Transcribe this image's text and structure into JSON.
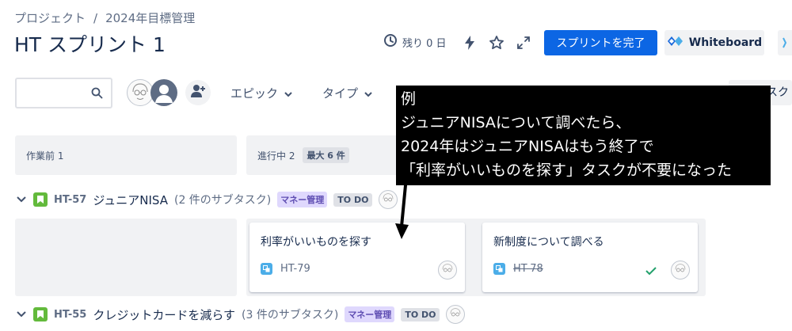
{
  "breadcrumb": {
    "project": "プロジェクト",
    "separator": "/",
    "board": "2024年目標管理"
  },
  "page_title": "HT スプリント 1",
  "header": {
    "days_left": "残り 0 日",
    "complete_sprint": "スプリントを完了",
    "whiteboard": "Whiteboard"
  },
  "filters": {
    "search_placeholder": "",
    "epic": "エピック",
    "type": "タイプ",
    "right_partial": "タスク"
  },
  "columns": [
    {
      "label": "作業前 1"
    },
    {
      "label": "進行中 2",
      "max_badge": "最大 6 件"
    }
  ],
  "swimlanes": [
    {
      "key": "HT-57",
      "title": "ジュニアNISA",
      "count": "(2 件のサブタスク)",
      "label": "マネー管理",
      "status": "TO DO"
    },
    {
      "key": "HT-55",
      "title": "クレジットカードを減らす",
      "count": "(3 件のサブタスク)",
      "label": "マネー管理",
      "status": "TO DO"
    }
  ],
  "cards": [
    {
      "title": "利率がいいものを探す",
      "key": "HT-79",
      "done": false
    },
    {
      "title": "新制度について調べる",
      "key": "HT-78",
      "done": true
    }
  ],
  "annotation": {
    "lines": [
      "例",
      "ジュニアNISAについて調べたら、",
      "2024年はジュニアNISAはもう終了で",
      "「利率がいいものを探す」タスクが不要になった"
    ]
  },
  "colors": {
    "primary": "#0c66e4",
    "story": "#63ba3c",
    "subtask": "#4bade8",
    "label_bg": "#dfd8fd",
    "label_text": "#5e4db2"
  }
}
